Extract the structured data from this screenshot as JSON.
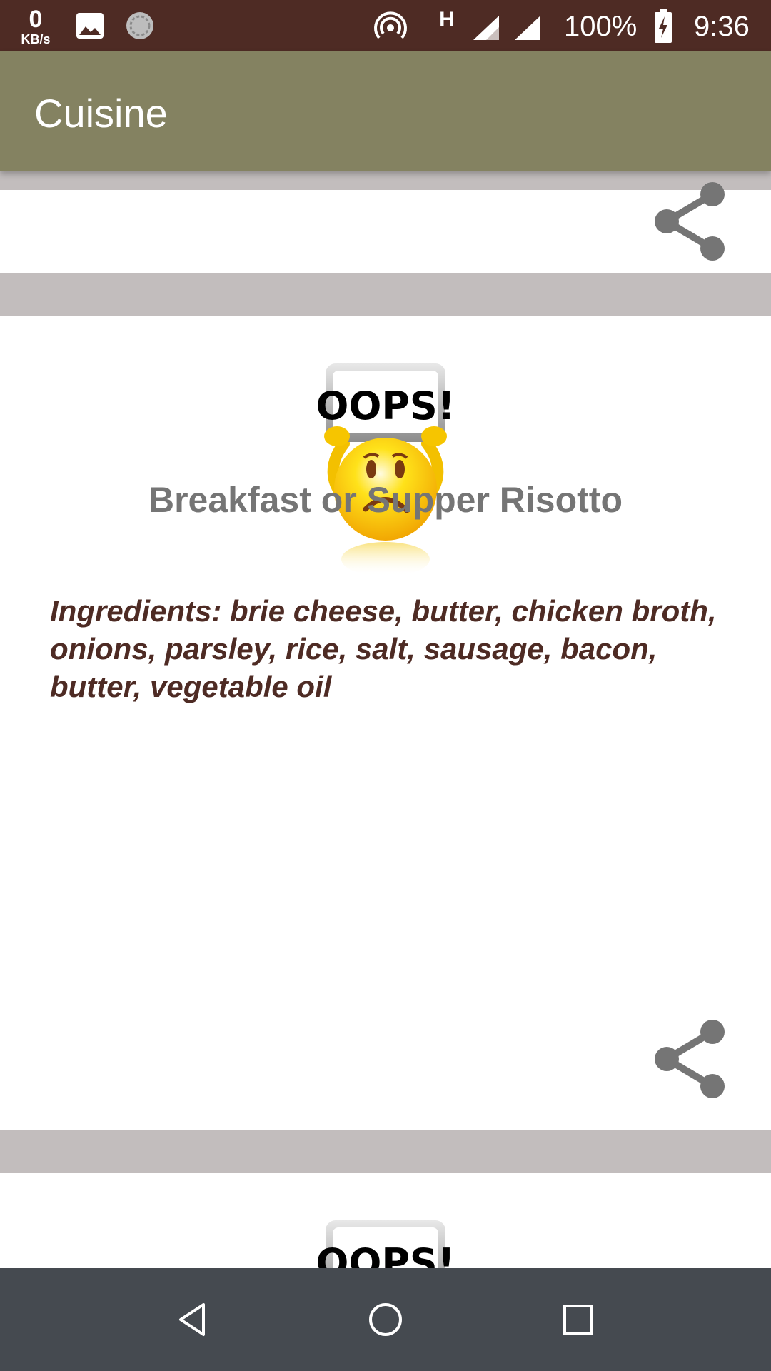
{
  "status_bar": {
    "net_speed_value": "0",
    "net_speed_unit": "KB/s",
    "network_type": "H",
    "battery_percent": "100%",
    "time": "9:36"
  },
  "app_bar": {
    "title": "Cuisine"
  },
  "recipes": [
    {
      "image_text": "OOPS!",
      "title": "Breakfast or Supper Risotto",
      "ingredients": "Ingredients: brie cheese, butter, chicken broth, onions, parsley, rice, salt, sausage, bacon, butter, vegetable oil"
    }
  ],
  "next_card": {
    "image_text": "OOPS!"
  },
  "icons": {
    "share": "share-icon",
    "back": "back-triangle-icon",
    "home": "home-circle-icon",
    "recents": "recents-square-icon"
  },
  "colors": {
    "status_bar": "#4e2b24",
    "app_bar": "#848261",
    "list_background": "#c2bdbd",
    "card": "#ffffff",
    "title_text": "#757575",
    "ingredients_text": "#4e2b24",
    "share_icon": "#757575",
    "nav_bar": "#454a50"
  }
}
